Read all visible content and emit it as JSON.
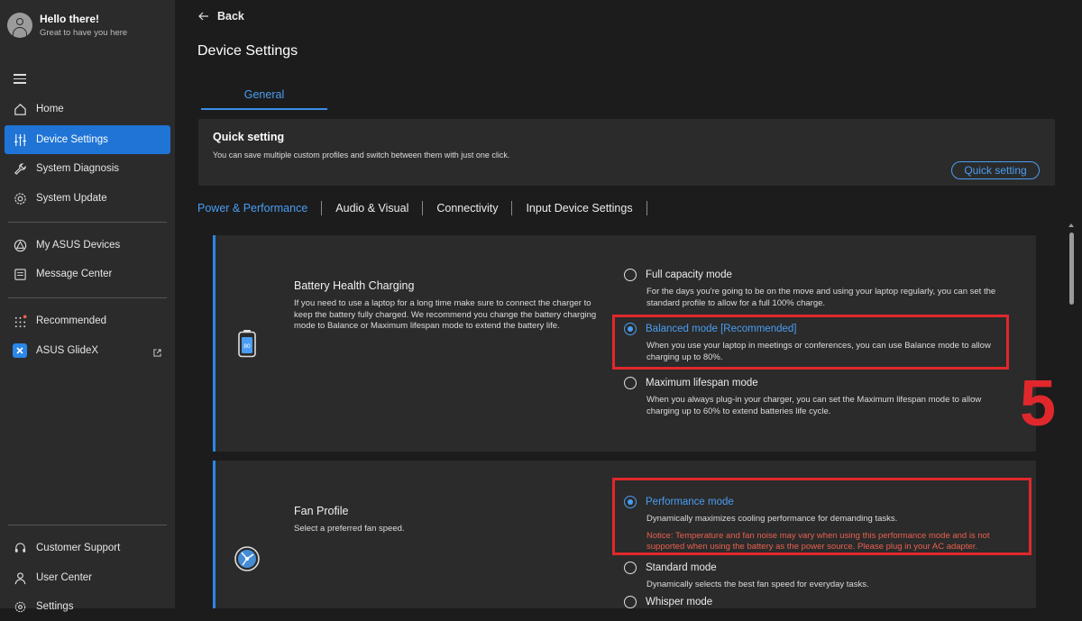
{
  "user": {
    "greeting": "Hello there!",
    "subtext": "Great to have you here"
  },
  "sidebar": {
    "items": [
      {
        "label": "Home",
        "icon": "home-icon"
      },
      {
        "label": "Device Settings",
        "icon": "sliders-icon",
        "active": true
      },
      {
        "label": "System Diagnosis",
        "icon": "wrench-icon"
      },
      {
        "label": "System Update",
        "icon": "update-icon"
      },
      {
        "label": "My ASUS Devices",
        "icon": "devices-icon"
      },
      {
        "label": "Message Center",
        "icon": "message-icon"
      },
      {
        "label": "Recommended",
        "icon": "grid-icon"
      },
      {
        "label": "ASUS GlideX",
        "icon": "glidex-icon"
      },
      {
        "label": "Customer Support",
        "icon": "headset-icon"
      },
      {
        "label": "User Center",
        "icon": "user-icon"
      },
      {
        "label": "Settings",
        "icon": "gear-icon"
      }
    ]
  },
  "header": {
    "back_label": "Back",
    "title": "Device Settings",
    "tab": "General"
  },
  "quick_setting": {
    "title": "Quick setting",
    "description": "You can save multiple custom profiles and switch between them with just one click.",
    "button": "Quick setting"
  },
  "subtabs": [
    "Power & Performance",
    "Audio & Visual",
    "Connectivity",
    "Input Device Settings"
  ],
  "battery": {
    "title": "Battery Health Charging",
    "description": "If you need to use a laptop for a long time make sure to connect the charger to keep the battery fully charged. We recommend you change the battery charging mode to Balance or Maximum lifespan mode to extend the battery life.",
    "icon_value": "80",
    "options": [
      {
        "label": "Full capacity mode",
        "desc": "For the days you're going to be on the move and using your laptop regularly, you can set the standard profile to allow for a full 100% charge.",
        "selected": false
      },
      {
        "label": "Balanced mode [Recommended]",
        "desc": "When you use your laptop in meetings or conferences, you can use Balance mode to allow charging up to 80%.",
        "selected": true
      },
      {
        "label": "Maximum lifespan mode",
        "desc": "When you always plug-in your charger, you can set the Maximum lifespan mode to allow charging up to 60% to extend batteries life cycle.",
        "selected": false
      }
    ]
  },
  "fan": {
    "title": "Fan Profile",
    "description": "Select a preferred fan speed.",
    "options": [
      {
        "label": "Performance mode",
        "desc": "Dynamically maximizes cooling performance for demanding tasks.",
        "notice": "Notice: Temperature and fan noise may vary when using this performance mode and is not supported when using the battery as the power source. Please plug in your AC adapter.",
        "selected": true
      },
      {
        "label": "Standard mode",
        "desc": "Dynamically selects the best fan speed for everyday tasks.",
        "selected": false
      },
      {
        "label": "Whisper mode",
        "selected": false
      }
    ]
  },
  "annotation": {
    "step": "5"
  },
  "colors": {
    "accent": "#1f74d6",
    "link": "#4a9df2",
    "highlight": "#e0282c",
    "notice": "#e8604e"
  }
}
